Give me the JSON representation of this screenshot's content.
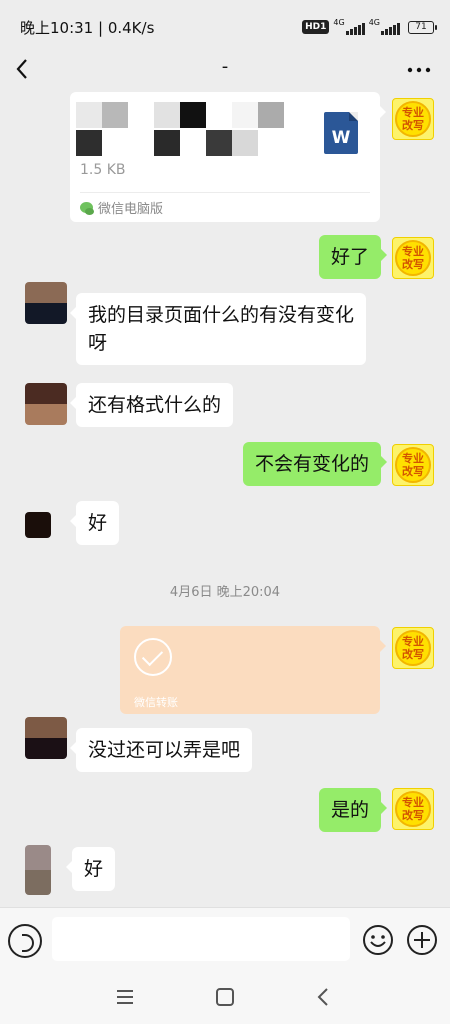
{
  "status_bar": {
    "time_speed": "晚上10:31 | 0.4K/s",
    "hd_badge": "HD1",
    "network_1": "4G",
    "network_2": "4G",
    "battery": "71"
  },
  "nav": {
    "title": "-"
  },
  "self_avatar_text": "专业\n改写",
  "file_card": {
    "size": "1.5 KB",
    "source": "微信电脑版",
    "file_type_letter": "W"
  },
  "messages": [
    {
      "side": "self",
      "text": "好了"
    },
    {
      "side": "other",
      "text": "我的目录页面什么的有没有变化\n呀"
    },
    {
      "side": "other",
      "text": "还有格式什么的"
    },
    {
      "side": "self",
      "text": "不会有变化的"
    },
    {
      "side": "other",
      "text": "好"
    },
    {
      "side": "other",
      "text": "没过还可以弄是吧"
    },
    {
      "side": "self",
      "text": "是的"
    },
    {
      "side": "other",
      "text": "好"
    }
  ],
  "time_divider": "4月6日 晚上20:04",
  "transfer": {
    "label": "微信转账"
  },
  "input": {
    "placeholder": ""
  },
  "colors": {
    "self_bubble": "#95ec69",
    "other_bubble": "#ffffff",
    "background": "#ededed",
    "transfer_card": "#fbdcbf"
  }
}
